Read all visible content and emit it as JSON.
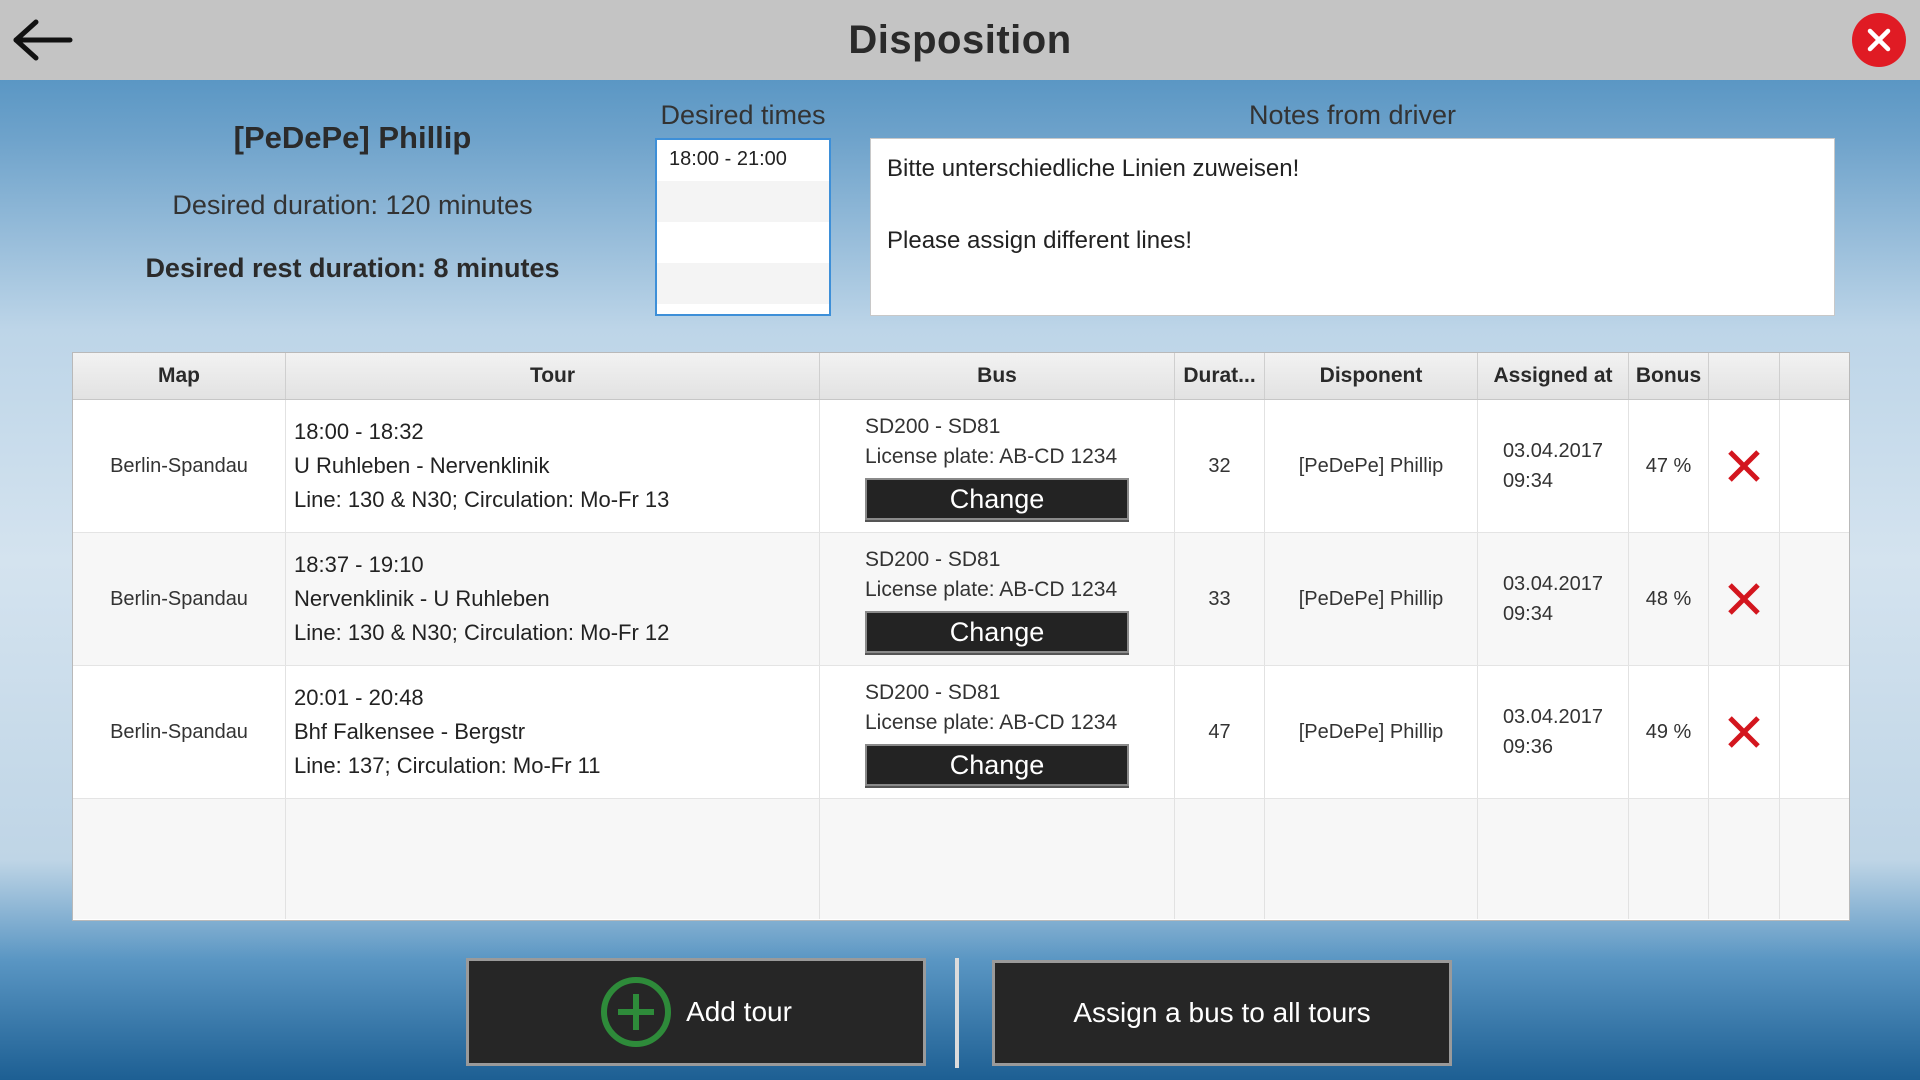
{
  "header": {
    "title": "Disposition",
    "back_icon": "arrow-left-icon",
    "close_icon": "close-icon"
  },
  "driver": {
    "name": "[PeDePe] Phillip",
    "desired_duration": "Desired duration: 120 minutes",
    "desired_rest": "Desired rest duration: 8 minutes"
  },
  "desired_times": {
    "label": "Desired times",
    "items": [
      "18:00 - 21:00",
      "",
      "",
      ""
    ]
  },
  "notes": {
    "label": "Notes from driver",
    "text": "Bitte unterschiedliche Linien zuweisen!\n\nPlease assign different lines!"
  },
  "table": {
    "columns": [
      "Map",
      "Tour",
      "Bus",
      "Durat...",
      "Disponent",
      "Assigned at",
      "Bonus",
      "",
      ""
    ],
    "rows": [
      {
        "map": "Berlin-Spandau",
        "tour_time": "18:00 - 18:32",
        "tour_route": "U Ruhleben - Nervenklinik",
        "tour_line": "Line: 130 & N30; Circulation: Mo-Fr 13",
        "bus_name": "SD200 - SD81",
        "bus_plate": "License plate: AB-CD 1234",
        "change_label": "Change",
        "duration": "32",
        "disponent": "[PeDePe] Phillip",
        "assigned_date": "03.04.2017",
        "assigned_time": "09:34",
        "bonus": "47 %"
      },
      {
        "map": "Berlin-Spandau",
        "tour_time": "18:37 - 19:10",
        "tour_route": "Nervenklinik - U Ruhleben",
        "tour_line": "Line: 130 & N30; Circulation: Mo-Fr 12",
        "bus_name": "SD200 - SD81",
        "bus_plate": "License plate: AB-CD 1234",
        "change_label": "Change",
        "duration": "33",
        "disponent": "[PeDePe] Phillip",
        "assigned_date": "03.04.2017",
        "assigned_time": "09:34",
        "bonus": "48 %"
      },
      {
        "map": "Berlin-Spandau",
        "tour_time": "20:01 - 20:48",
        "tour_route": "Bhf Falkensee - Bergstr",
        "tour_line": "Line: 137; Circulation: Mo-Fr 11",
        "bus_name": "SD200 - SD81",
        "bus_plate": "License plate: AB-CD 1234",
        "change_label": "Change",
        "duration": "47",
        "disponent": "[PeDePe] Phillip",
        "assigned_date": "03.04.2017",
        "assigned_time": "09:36",
        "bonus": "49 %"
      }
    ]
  },
  "footer": {
    "add_tour_label": "Add tour",
    "add_tour_icon": "plus-circle-icon",
    "assign_bus_label": "Assign a bus to all tours"
  },
  "colors": {
    "accent_red": "#e01b24",
    "delete_red": "#d3161e",
    "plus_green": "#2e8b3a",
    "button_dark": "#262626"
  }
}
